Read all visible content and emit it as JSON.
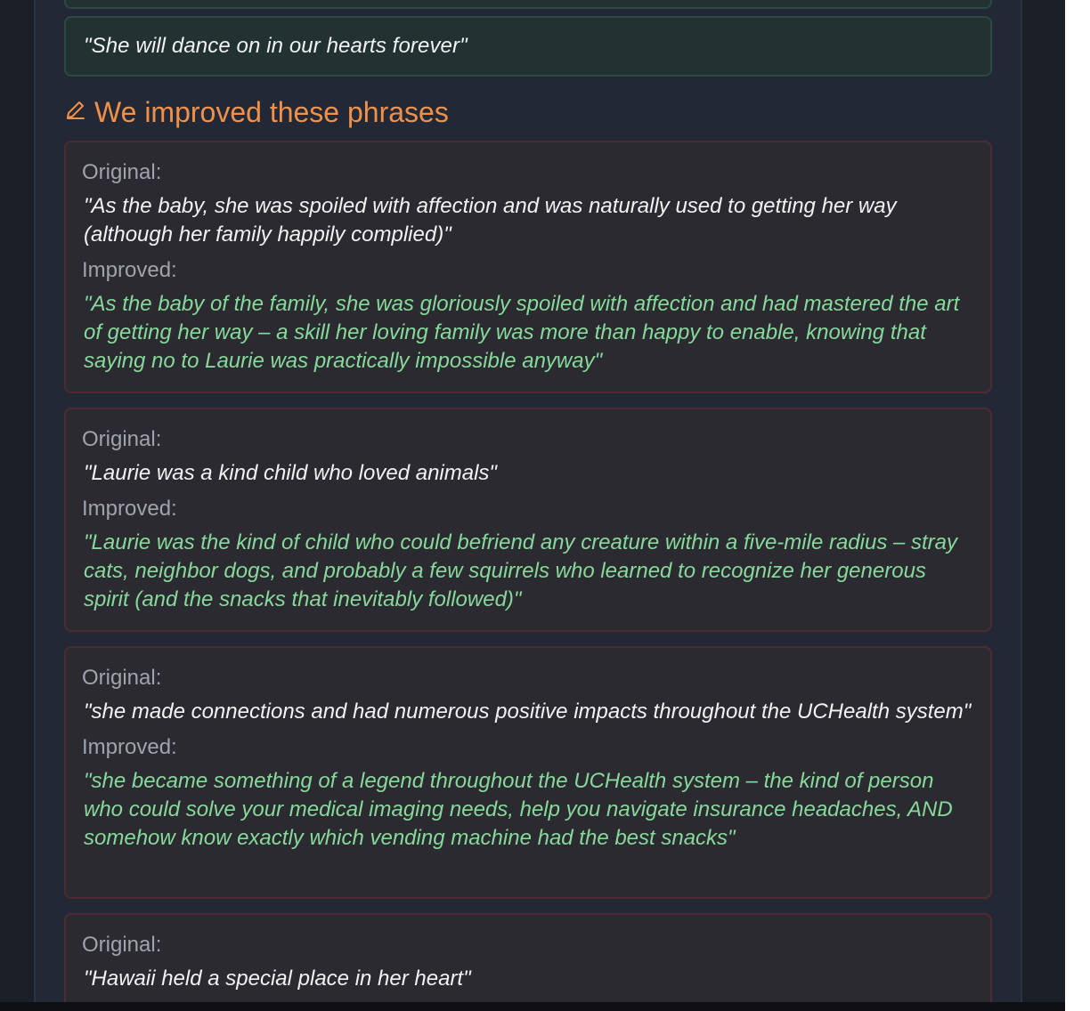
{
  "quote": "\"She will dance on in our hearts forever\"",
  "section": {
    "icon": "pencil-icon",
    "title": "We improved these phrases",
    "accent_color": "#f0914a"
  },
  "labels": {
    "original": "Original:",
    "improved": "Improved:"
  },
  "phrases": [
    {
      "original": "\"As the baby, she was spoiled with affection and was naturally used to getting her way (although her family happily complied)\"",
      "improved": "\"As the baby of the family, she was gloriously spoiled with affection and had mastered the art of getting her way – a skill her loving family was more than happy to enable, knowing that saying no to Laurie was practically impossible anyway\""
    },
    {
      "original": "\"Laurie was a kind child who loved animals\"",
      "improved": "\"Laurie was the kind of child who could befriend any creature within a five-mile radius – stray cats, neighbor dogs, and probably a few squirrels who learned to recognize her generous spirit (and the snacks that inevitably followed)\""
    },
    {
      "original": "\"she made connections and had numerous positive impacts throughout the UCHealth system\"",
      "improved": "\"she became something of a legend throughout the UCHealth system – the kind of person who could solve your medical imaging needs, help you navigate insurance headaches, AND somehow know exactly which vending machine had the best snacks\""
    },
    {
      "original": "\"Hawaii held a special place in her heart\""
    }
  ]
}
